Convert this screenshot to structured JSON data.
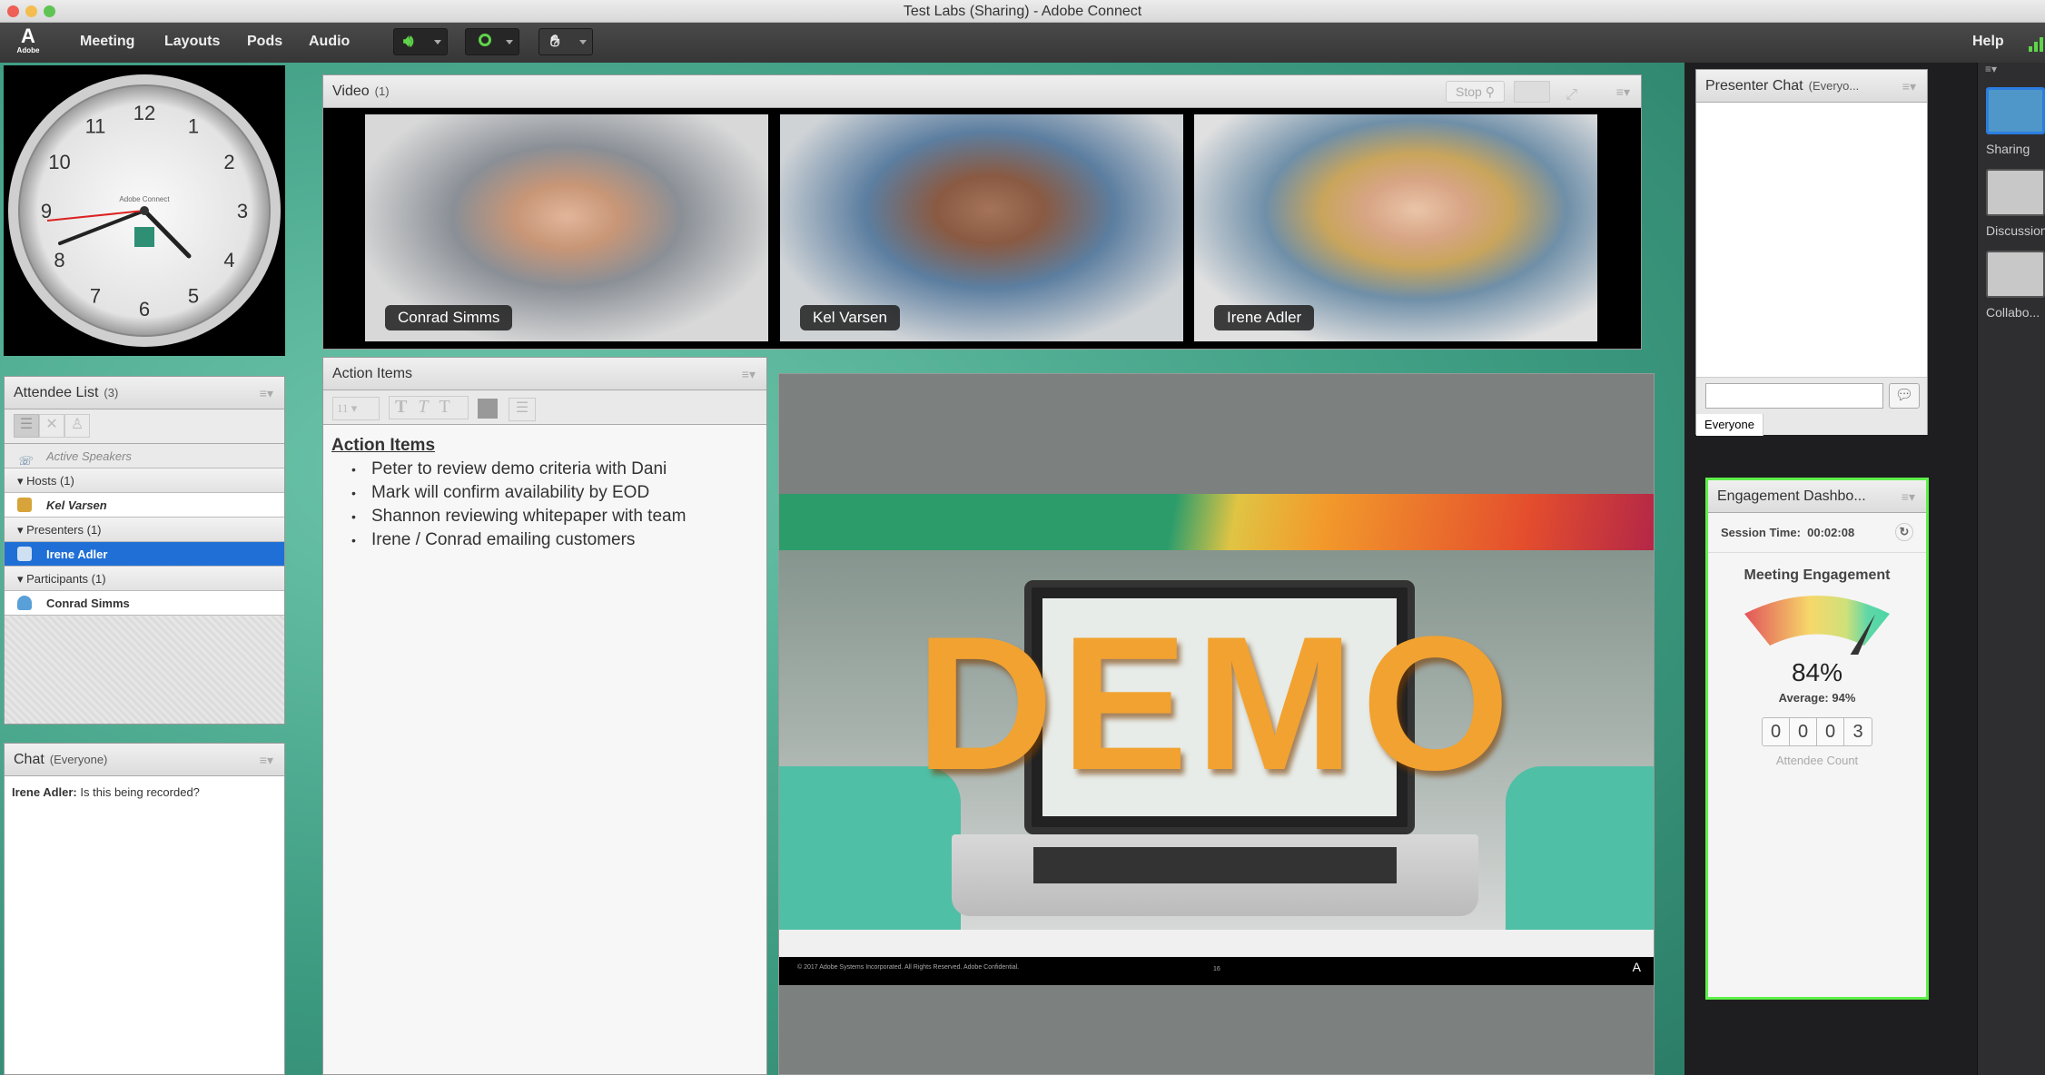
{
  "window": {
    "title": "Test Labs (Sharing) - Adobe Connect"
  },
  "menubar": {
    "logo": "Adobe",
    "items": [
      "Meeting",
      "Layouts",
      "Pods",
      "Audio"
    ],
    "help": "Help",
    "icons": [
      "speaker-icon",
      "webcam-icon",
      "raise-hand-icon",
      "signal-strength-icon"
    ],
    "accent": "#5fd44a"
  },
  "clock": {
    "brand": "Adobe Connect",
    "numbers": [
      "12",
      "1",
      "2",
      "3",
      "4",
      "5",
      "6",
      "7",
      "8",
      "9",
      "10",
      "11"
    ]
  },
  "video": {
    "title": "Video",
    "count": "(1)",
    "stop_label": "Stop",
    "tiles": [
      {
        "name": "Conrad Simms"
      },
      {
        "name": "Kel Varsen"
      },
      {
        "name": "Irene Adler"
      }
    ]
  },
  "attendees": {
    "title": "Attendee List",
    "count": "(3)",
    "active_speakers": "Active Speakers",
    "groups": [
      {
        "label": "Hosts (1)",
        "members": [
          "Kel Varsen"
        ]
      },
      {
        "label": "Presenters (1)",
        "members": [
          "Irene Adler"
        ]
      },
      {
        "label": "Participants (1)",
        "members": [
          "Conrad Simms"
        ]
      }
    ],
    "selected": "Irene Adler",
    "selected_color": "#1f6fd6"
  },
  "chat": {
    "title": "Chat",
    "scope": "(Everyone)",
    "messages": [
      {
        "sender": "Irene Adler:",
        "text": " Is this being recorded?"
      }
    ]
  },
  "action_items": {
    "title": "Action Items",
    "font_size": "11",
    "heading": "Action Items",
    "items": [
      "Peter to review demo criteria with Dani",
      "Mark will confirm availability by EOD",
      "Shannon reviewing whitepaper with team",
      "Irene / Conrad emailing customers"
    ]
  },
  "share": {
    "slide_word": "DEMO",
    "footer": "© 2017 Adobe Systems Incorporated. All Rights Reserved. Adobe Confidential.",
    "page": "16",
    "logo": "Adobe"
  },
  "presenter_chat": {
    "title": "Presenter Chat",
    "scope": "(Everyo...",
    "input_placeholder": "",
    "tab": "Everyone"
  },
  "engagement": {
    "title": "Engagement Dashbo...",
    "session_label": "Session Time:",
    "session_time": "00:02:08",
    "heading": "Meeting Engagement",
    "value": "84%",
    "value_pct": 84,
    "average": "Average: 94%",
    "attendee_digits": [
      "0",
      "0",
      "0",
      "3"
    ],
    "attendee_label": "Attendee Count",
    "border_color": "#5ef04a"
  },
  "layouts": {
    "items": [
      "Sharing",
      "Discussion",
      "Collabo..."
    ],
    "selected": "Sharing"
  }
}
